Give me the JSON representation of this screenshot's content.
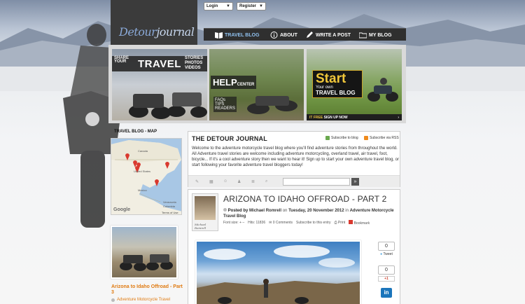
{
  "header": {
    "logo_part1": "Detour",
    "logo_part2": "journal",
    "login_select": "Login",
    "register_select": "Register"
  },
  "nav": {
    "items": [
      {
        "label": "TRAVEL BLOG",
        "icon": "book-icon",
        "active": true
      },
      {
        "label": "ABOUT",
        "icon": "info-icon",
        "active": false
      },
      {
        "label": "WRITE A POST",
        "icon": "pencil-icon",
        "active": false
      },
      {
        "label": "MY BLOG",
        "icon": "folder-icon",
        "active": false
      }
    ]
  },
  "banners": {
    "share": {
      "line1": "SHARE",
      "line2": "YOUR",
      "big": "TRAVEL",
      "stack1": "STORIES",
      "stack2": "PHOTOS",
      "stack3": "VIDEOS"
    },
    "help": {
      "big": "HELP",
      "small": "CENTER",
      "l1": "FAQs",
      "l2": "TIPS",
      "l3": "READERS"
    },
    "start": {
      "big": "Start",
      "small": "Your own",
      "blog": "TRAVEL BLOG",
      "foot_a": "IT FREE",
      "foot_b": "SIGN UP NOW",
      "foot_arrow": "›"
    }
  },
  "sidebar": {
    "map_title": "TRAVEL BLOG - MAP",
    "map_labels": {
      "canada": "Canada",
      "us": "United States",
      "mexico": "Mexico",
      "venezuela": "Venezuela",
      "colombia": "Colombia",
      "google": "Google",
      "terms": "Terms of Use"
    },
    "post_link": "Arizona to Idaho Offroad - Part 3",
    "post_category": "Adventure Motorcycle Travel"
  },
  "journal": {
    "title": "THE DETOUR JOURNAL",
    "subscribe_blog": "Subscribe to blog",
    "subscribe_rss": "Subscribe via RSS",
    "description": "Welcome to the adventure motorcycle travel blog where you'll find adventure stories from throughout the world. All Adventure travel stories are welcome including adventure motorcycling, overland travel, air travel, foot, bicycle... If it's a cool adventure story then we want to hear it! Sign up to start your own adventure travel blog, or start following your favorite adventure travel bloggers today!",
    "search_go": "»"
  },
  "article": {
    "author_caption": "Michael Romrell",
    "title": "ARIZONA TO IDAHO OFFROAD - PART 2",
    "posted_by": "Posted by",
    "author": "Michael Romrell",
    "on": "on",
    "date": "Tuesday, 20 November 2012",
    "in": "in",
    "category": "Adventure Motorcycle Travel Blog",
    "font_size": "Font size:",
    "font_plus": "+",
    "font_minus": "–",
    "hits": "Hits: 11836",
    "comments": "0 Comments",
    "subscribe_entry": "Subscribe to this entry",
    "print": "Print",
    "bookmark": "Bookmark"
  },
  "share": {
    "tweet_count": "0",
    "tweet_label": "Tweet",
    "gplus_count": "0",
    "gplus_label": "+1",
    "linkedin_label": "in"
  },
  "colors": {
    "accent_orange": "#e07b12",
    "nav_active": "#8fc0ee",
    "nav_bg": "#2f2f2f"
  }
}
